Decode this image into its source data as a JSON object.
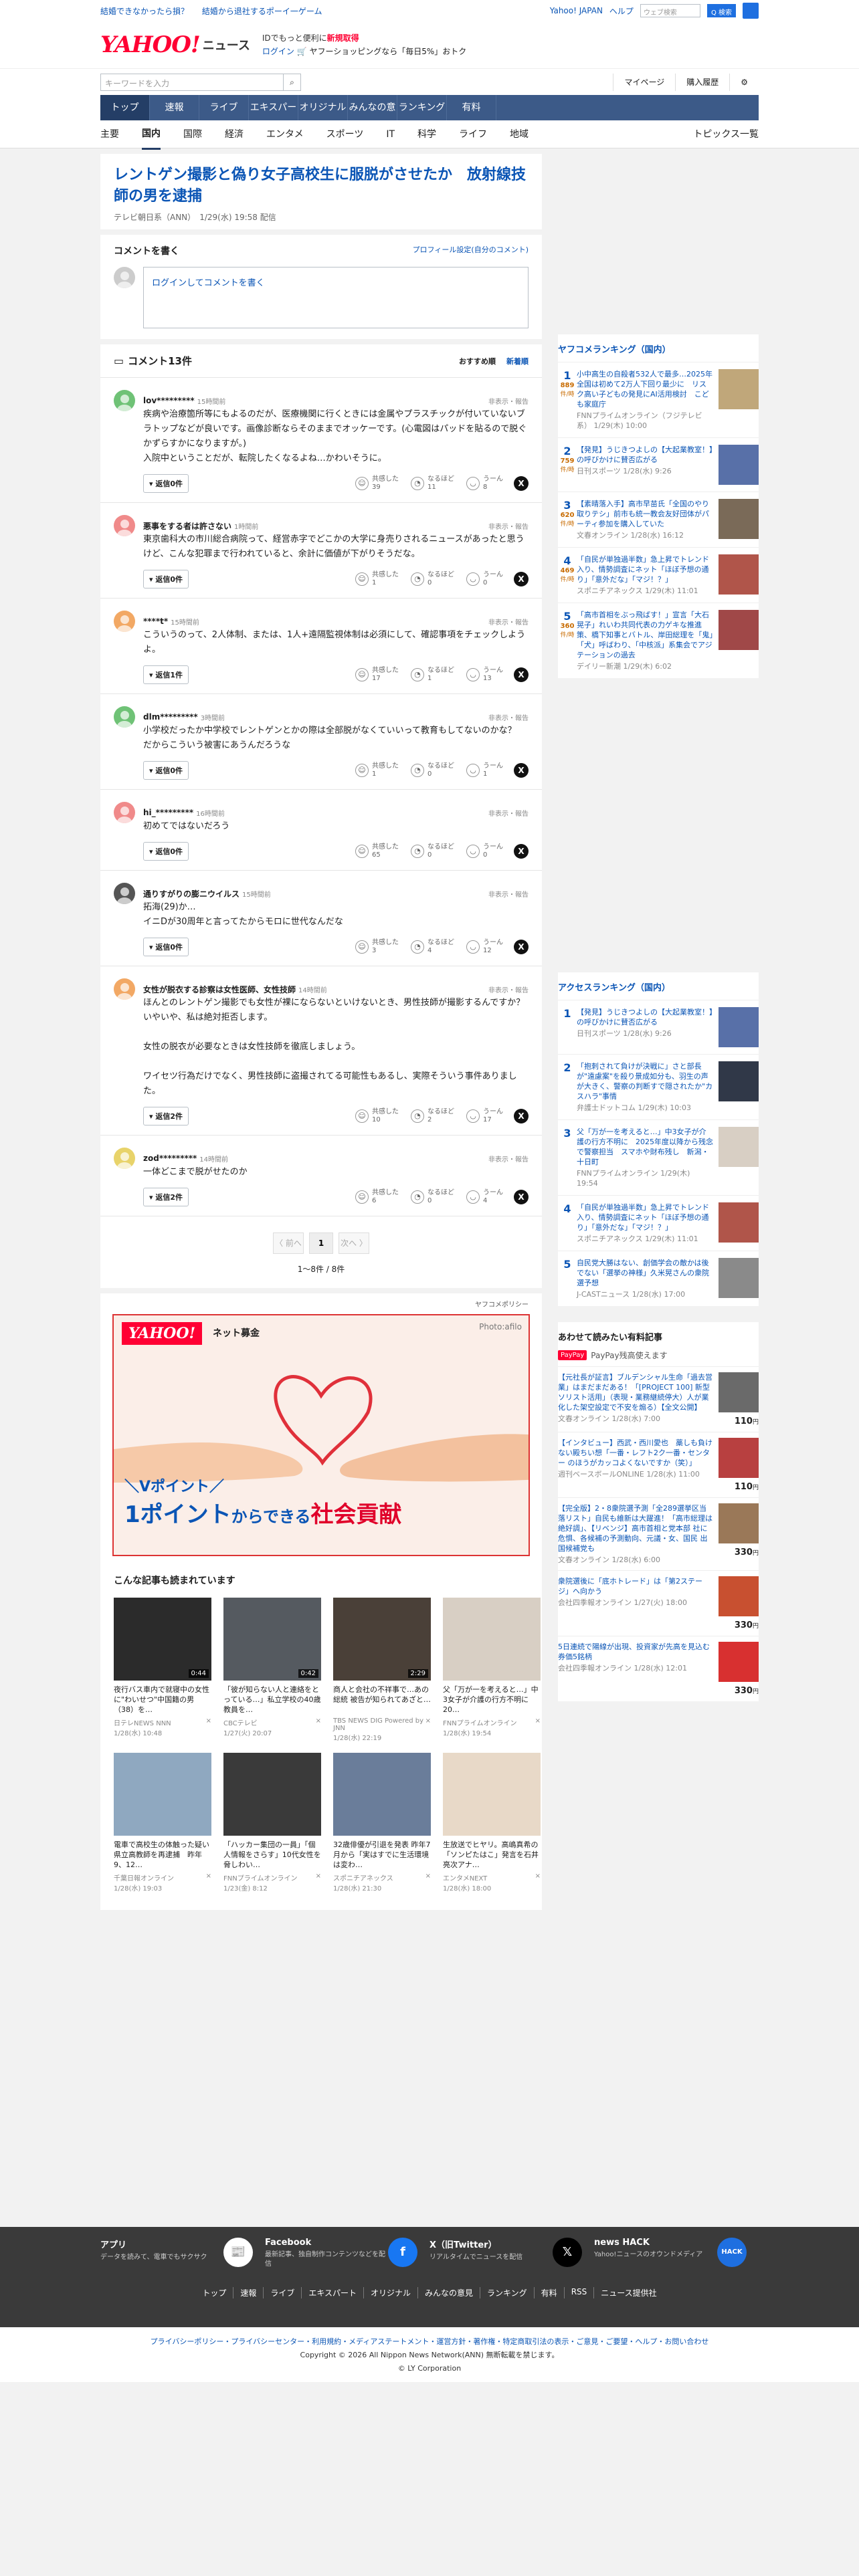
{
  "topbar": {
    "left": [
      "結婚できなかったら損？",
      "結婚から退社するポーイ一ゲーム"
    ],
    "login": "Yahoo! JAPAN",
    "help": "ヘルプ",
    "search_placeholder": "ウェブ検索",
    "search_btn": "Q 検索"
  },
  "header": {
    "logo": "YAHOO!",
    "logo_sub": "JAPAN",
    "site": "ニュース",
    "promo1": "IDでもっと便利に",
    "promo1b": "新規取得",
    "promo2_login": "ログイン",
    "promo2": "🛒 ヤフーショッピングなら「毎日5%」おトク"
  },
  "searchrow": {
    "placeholder": "キーワードを入力",
    "mypage": "マイページ",
    "history": "購入履歴",
    "gear": "⚙"
  },
  "nav": {
    "items": [
      "トップ",
      "速報",
      "ライブ",
      "エキスパート",
      "オリジナル",
      "みんなの意見",
      "ランキング",
      "有料"
    ]
  },
  "subnav": {
    "items": [
      "主要",
      "国内",
      "国際",
      "経済",
      "エンタメ",
      "スポーツ",
      "IT",
      "科学",
      "ライフ",
      "地域"
    ],
    "topics": "トピックス一覧"
  },
  "article": {
    "title": "レントゲン撮影と偽り女子高校生に服脱がさせたか　放射線技師の男を逮捕",
    "source": "テレビ朝日系（ANN）",
    "date": "1/29(水) 19:58 配信"
  },
  "comment_write": {
    "heading": "コメントを書く",
    "profile": "プロフィール設定(自分のコメント)",
    "login": "ログイン",
    "placeholder": "してコメントを書く"
  },
  "comments_head": {
    "title": "コメント13件",
    "sort1": "おすすめ順",
    "sort2": "新着順"
  },
  "comments": [
    {
      "name": "lov*********",
      "time": "15時間前",
      "text": "疾病や治療箇所等にもよるのだが、医療機関に行くときには金属やプラスチックが付いていないブラトップなどが良いです。画像診断ならそのままでオッケーです。(心電図はパッドを貼るので脱ぐかずらすかになりますが。)\n入院中ということだが、転院したくなるよね…かわいそうに。",
      "reply": "返信0件",
      "r1": "共感した",
      "c1": "39",
      "r2": "なるほど",
      "c2": "11",
      "r3": "うーん",
      "c3": "8",
      "color": "#6fc276"
    },
    {
      "name": "悪事をする者は許さない",
      "time": "1時間前",
      "text": "東京歯科大の市川総合病院って、経営赤字でどこかの大学に身売りされるニュースがあったと思うけど、こんな犯罪まで行われていると、余計に価値が下がりそうだな。",
      "reply": "返信0件",
      "r1": "共感した",
      "c1": "1",
      "r2": "なるほど",
      "c2": "0",
      "r3": "うーん",
      "c3": "0",
      "color": "#f08a8a"
    },
    {
      "name": "****t*",
      "time": "15時間前",
      "text": "こういうのって、2人体制、または、1人+遠隔監視体制は必須にして、確認事項をチェックしようよ。",
      "reply": "返信1件",
      "r1": "共感した",
      "c1": "17",
      "r2": "なるほど",
      "c2": "1",
      "r3": "うーん",
      "c3": "13",
      "color": "#f2a864"
    },
    {
      "name": "dlm*********",
      "time": "3時間前",
      "text": "小学校だったか中学校でレントゲンとかの際は全部脱がなくていいって教育もしてないのかな？\nだからこういう被害にあうんだろうな",
      "reply": "返信0件",
      "r1": "共感した",
      "c1": "1",
      "r2": "なるほど",
      "c2": "0",
      "r3": "うーん",
      "c3": "1",
      "color": "#6fc276"
    },
    {
      "name": "hi_*********",
      "time": "16時間前",
      "text": "初めてではないだろう",
      "reply": "返信0件",
      "r1": "共感した",
      "c1": "65",
      "r2": "なるほど",
      "c2": "0",
      "r3": "うーん",
      "c3": "0",
      "color": "#f08a8a"
    },
    {
      "name": "通りすがりの膨ニウイルス",
      "time": "15時間前",
      "text": "拓海(29)か…\nイニDが30周年と言ってたからモロに世代なんだな",
      "reply": "返信0件",
      "r1": "共感した",
      "c1": "3",
      "r2": "なるほど",
      "c2": "4",
      "r3": "うーん",
      "c3": "12",
      "color": "#555555"
    },
    {
      "name": "女性が脱衣する診察は女性医師、女性技師",
      "time": "14時間前",
      "text": "ほんとのレントゲン撮影でも女性が裸にならないといけないとき、男性技師が撮影するんですか？\nいやいや、私は絶対拒否します。\n\n女性の脱衣が必要なときは女性技師を徹底しましょう。\n\nワイセツ行為だけでなく、男性技師に盗撮されてる可能性もあるし、実際そういう事件ありました。",
      "reply": "返信2件",
      "r1": "共感した",
      "c1": "10",
      "r2": "なるほど",
      "c2": "2",
      "r3": "うーん",
      "c3": "17",
      "color": "#f2a864"
    },
    {
      "name": "zod*********",
      "time": "14時間前",
      "text": "一体どこまで脱がせたのか",
      "reply": "返信2件",
      "r1": "共感した",
      "c1": "6",
      "r2": "なるほど",
      "c2": "0",
      "r3": "うーん",
      "c3": "4",
      "color": "#e8d36a"
    }
  ],
  "report": "非表示・報告",
  "pager": {
    "prev": "〈 前へ",
    "page": "1",
    "next": "次へ 〉",
    "count": "1〜8件 / 8件"
  },
  "ad": {
    "policy": "ヤフコメポリシー",
    "brand": "YAHOO!",
    "brand_sub": "JAPAN",
    "title": "ネット募金",
    "photo": "Photo:afilo",
    "vpoint": "＼Vポイント／",
    "msg1": "1ポイント",
    "msg2": "からできる",
    "msg3": "社会貢献"
  },
  "related": {
    "heading": "こんな記事も読まれています",
    "items": [
      {
        "title": "夜行バス車内で就寝中の女性に\"わいせつ\"中国籍の男（38）を…",
        "src": "日テレNEWS NNN",
        "date": "1/28(水) 10:48",
        "dur": "0:44",
        "bg": "#2b2b2b"
      },
      {
        "title": "「彼が知らない人と連絡をとっている…」私立学校の40歳教員を…",
        "src": "CBCテレビ",
        "date": "1/27(火) 20:07",
        "dur": "0:42",
        "bg": "#555a60"
      },
      {
        "title": "商人と会社の不祥事で…あの総統 被告が知られてあざと…",
        "src": "TBS NEWS DIG Powered by JNN",
        "date": "1/28(水) 22:19",
        "dur": "2:29",
        "bg": "#4a4038"
      },
      {
        "title": "父「万が一を考えると…」中3女子が介護の行方不明に 20…",
        "src": "FNNプライムオンライン",
        "date": "1/28(水) 19:54",
        "dur": "",
        "bg": "#d8cfc4"
      },
      {
        "title": "電車で高校生の体触った疑い　県立高教師を再逮捕　昨年9、12…",
        "src": "千葉日報オンライン",
        "date": "1/28(水) 19:03",
        "dur": "",
        "bg": "#8fa8c0"
      },
      {
        "title": "「ハッカー集団の一員」「個人情報をさらす」10代女性を脅しわい…",
        "src": "FNNプライムオンライン",
        "date": "1/23(金) 8:12",
        "dur": "",
        "bg": "#3a3a3a"
      },
      {
        "title": "32歳俳優が引退を発表 昨年7月から「実はすでに生活環境は変わ…",
        "src": "スポニチアネックス",
        "date": "1/28(水) 21:30",
        "dur": "",
        "bg": "#6a7d9a"
      },
      {
        "title": "生放送でヒヤリ。高嶋真希の「ソンピたはこ」発言を石井亮次アナ…",
        "src": "エンタメNEXT",
        "date": "1/28(水) 18:00",
        "dur": "",
        "bg": "#e8d9c8"
      }
    ]
  },
  "ranking1": {
    "heading": "ヤフコメランキング（国内）",
    "items": [
      {
        "no": "1",
        "count": "889",
        "unit": "件/時",
        "title": "小中高生の自殺者532人で最多…2025年全国は初めて2万人下回り最少に　リスク高い子どもの発見にAI活用検討　こども家庭庁",
        "src": "FNNプライムオンライン（フジテレビ系）",
        "date": "1/29(木) 10:00",
        "bg": "#c0a77a"
      },
      {
        "no": "2",
        "count": "759",
        "unit": "件/時",
        "title": "【発見】うじきつよしの【大起業教室！】の呼びかけに賛否広がる",
        "src": "日刊スポーツ",
        "date": "1/28(水) 9:26",
        "bg": "#5870a8"
      },
      {
        "no": "3",
        "count": "620",
        "unit": "件/時",
        "title": "【素晴落入手】高市早苗氏「全国のやり取りテシ」前市も統一教会友好団体がパーティ参加を購入していた",
        "src": "文春オンライン",
        "date": "1/28(水) 16:12",
        "bg": "#7a6a58"
      },
      {
        "no": "4",
        "count": "469",
        "unit": "件/時",
        "title": "「自民が単独過半数」急上昇でトレンド入り、情勢調査にネット「ほぼ予想の通り」「意外だな」「マジ！？」",
        "src": "スポニチアネックス",
        "date": "1/29(木) 11:01",
        "bg": "#b0554a"
      },
      {
        "no": "5",
        "count": "360",
        "unit": "件/時",
        "title": "「高市首相をぶっ飛ばす！」宣言「大石晃子」れいわ共同代表の力ゲキな推進策、橋下知事とバトル、岸田総理を「鬼」「犬」呼ばわり、「中核派」系集会でアジテーションの過去",
        "src": "デイリー新潮",
        "date": "1/29(木) 6:02",
        "bg": "#a04848"
      }
    ]
  },
  "ranking2": {
    "heading": "アクセスランキング（国内）",
    "items": [
      {
        "no": "1",
        "title": "【発見】うじきつよしの【大起業教室！】の呼びかけに賛否広がる",
        "src": "日刊スポーツ",
        "date": "1/28(水) 9:26",
        "bg": "#5870a8"
      },
      {
        "no": "2",
        "title": "「抱刺されて負けが決戦に」さと部長が\"遠慮案\"を殺り景成如分も、羽生の声が大きく、警察の判断すで隠されたか\"カスハラ\"事情",
        "src": "弁護士ドットコム",
        "date": "1/29(木) 10:03",
        "bg": "#303848"
      },
      {
        "no": "3",
        "title": "父「万が一を考えると…」中3女子が介護の行方不明に　2025年度以降から残念で警察担当　スマホや財布残し　新潟・十日町",
        "src": "FNNプライムオンライン",
        "date": "1/29(木) 19:54",
        "bg": "#d8cfc4"
      },
      {
        "no": "4",
        "title": "「自民が単独過半数」急上昇でトレンド入り、情勢調査にネット「ほぼ予想の通り」「意外だな」「マジ！？」",
        "src": "スポニチアネックス",
        "date": "1/29(木) 11:01",
        "bg": "#b0554a"
      },
      {
        "no": "5",
        "title": "自民党大勝はない、創価学会の敵かは後でない「選挙の神様」久米晃さんの衆院選予想",
        "src": "J-CASTニュース",
        "date": "1/28(水) 17:00",
        "bg": "#8a8a8a"
      }
    ]
  },
  "paypay": {
    "heading": "あわせて読みたい有料記事",
    "badge": "PayPay",
    "sub": "PayPay残高使えます",
    "items": [
      {
        "title": "【元社長が証言】ブルデンシャル生命「過去営業」はまだまだある！「[PROJECT 100] 新型ソリスト活用」（表現・業務継続停大）人が業化した架空設定で不安を煽る）【全文公開】",
        "src": "文春オンライン",
        "date": "1/28(水) 7:00",
        "price": "110",
        "bg": "#6a6a6a"
      },
      {
        "title": "【インタビュー】西武・西川愛也　藁しも負けない殿ちい想「一番・レフト2ク一番・センター のほうがカッコよくないですか（笑）」",
        "src": "週刊ベースボールONLINE",
        "date": "1/28(水) 11:00",
        "price": "110",
        "bg": "#b84040"
      },
      {
        "title": "【完全版】2・8衆院選予測「全289選挙区当落リスト」自民も維新は大躍進！「高市総理は絶好調」、【リベンジ】高市首相と党本部 社に危惧、各候補の予測動向、元議・女、国民 出国候補党も",
        "src": "文春オンライン",
        "date": "1/28(水) 6:00",
        "price": "330",
        "bg": "#9a7858"
      },
      {
        "title": "衆院選後に「底ホトレード」は「第2ステージ」へ向かう",
        "src": "会社四季報オンライン",
        "date": "1/27(火) 18:00",
        "price": "330",
        "bg": "#c85030"
      },
      {
        "title": "5日連続で陽線が出現、投資家が先高を見込む券価5銘柄",
        "src": "会社四季報オンライン",
        "date": "1/28(水) 12:01",
        "price": "330",
        "bg": "#d83030"
      }
    ],
    "unit": "円"
  },
  "footer": {
    "cols": [
      {
        "title": "アプリ",
        "desc": "データを読みて、電車でもサクサク",
        "icon": "📰",
        "color": "#fff"
      },
      {
        "title": "Facebook",
        "desc": "最新記事、独自制作コンテンツなどを配信",
        "icon": "f",
        "color": "#1877f2"
      },
      {
        "title": "X（旧Twitter）",
        "desc": "リアルタイムでニュースを配信",
        "icon": "𝕏",
        "color": "#000"
      },
      {
        "title": "news HACK",
        "desc": "Yahoo!ニュースのオウンドメディア",
        "icon": "HACK",
        "color": "#1e6fe0"
      }
    ],
    "links": [
      "トップ",
      "速報",
      "ライブ",
      "エキスパート",
      "オリジナル",
      "みんなの意見",
      "ランキング",
      "有料",
      "RSS",
      "ニュース提供社"
    ],
    "legal": "プライバシーポリシー・プライバシーセンター・利用規約・メディアステートメント・運営方針・著作権・特定商取引法の表示・ご意見・ご要望・ヘルプ・お問い合わせ",
    "copy1": "Copyright © 2026 All Nippon News Network(ANN) 無断転載を禁じます。",
    "copy2": "© LY Corporation"
  }
}
